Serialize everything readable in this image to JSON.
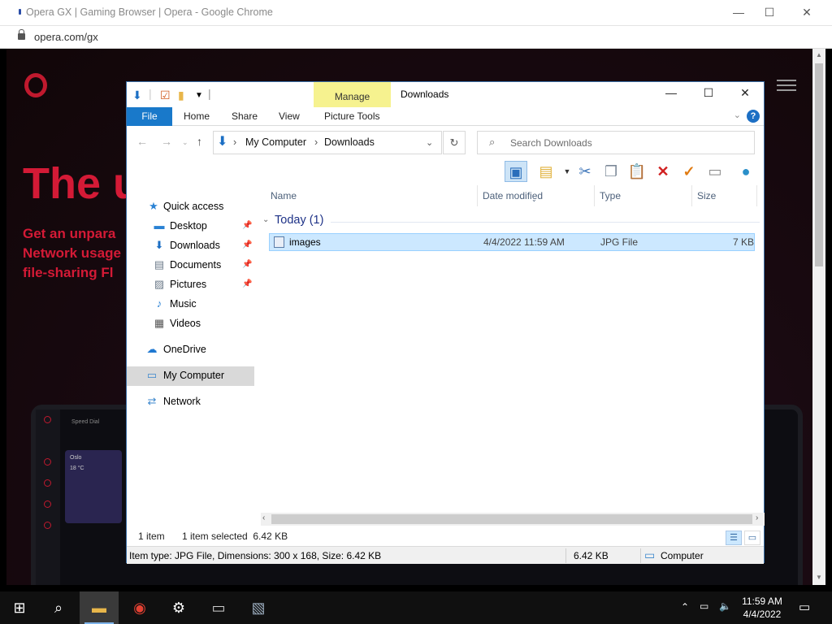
{
  "chrome": {
    "title": "Opera GX | Gaming Browser | Opera - Google Chrome",
    "url": "opera.com/gx",
    "minimize": "—",
    "maximize": "☐",
    "close": "✕"
  },
  "opera_page": {
    "hero_title": "The u",
    "hero_lines": [
      "Get an unpara",
      "Network usage",
      "file-sharing Fl"
    ],
    "speed_dial_label": "Speed Dial",
    "weather_city": "Oslo",
    "weather_temp": "18 °C"
  },
  "explorer": {
    "window_title": "Downloads",
    "manage_tab": "Manage",
    "ribbon_tabs": {
      "file": "File",
      "home": "Home",
      "share": "Share",
      "view": "View",
      "picture_tools": "Picture Tools"
    },
    "help": "?",
    "breadcrumb": [
      "My Computer",
      "Downloads"
    ],
    "search_placeholder": "Search Downloads",
    "nav": {
      "quick_access": "Quick access",
      "desktop": "Desktop",
      "downloads": "Downloads",
      "documents": "Documents",
      "pictures": "Pictures",
      "music": "Music",
      "videos": "Videos",
      "onedrive": "OneDrive",
      "my_computer": "My Computer",
      "network": "Network"
    },
    "columns": {
      "name": "Name",
      "date": "Date modified",
      "type": "Type",
      "size": "Size"
    },
    "group_label": "Today (1)",
    "files": [
      {
        "name": "images",
        "date": "4/4/2022 11:59 AM",
        "type": "JPG File",
        "size": "7 KB"
      }
    ],
    "status": {
      "item_count": "1 item",
      "selected": "1 item selected  6.42 KB",
      "details": "Item type: JPG File, Dimensions: 300 x 168, Size: 6.42 KB",
      "size": "6.42 KB",
      "location": "Computer"
    }
  },
  "taskbar": {
    "time": "11:59 AM",
    "date": "4/4/2022"
  }
}
